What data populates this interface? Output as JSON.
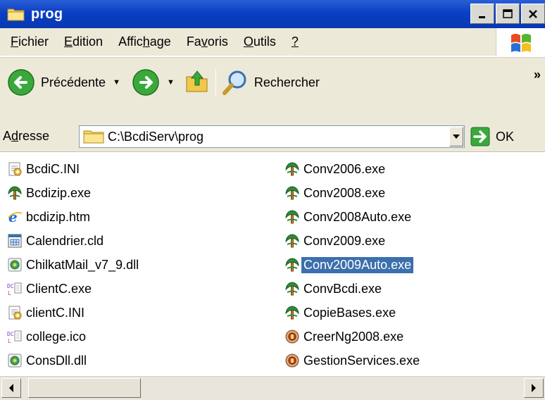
{
  "window": {
    "title": "prog"
  },
  "menu": [
    {
      "pre": "",
      "u": "F",
      "post": "ichier"
    },
    {
      "pre": "",
      "u": "E",
      "post": "dition"
    },
    {
      "pre": "Affic",
      "u": "h",
      "post": "age"
    },
    {
      "pre": "Fa",
      "u": "v",
      "post": "oris"
    },
    {
      "pre": "",
      "u": "O",
      "post": "utils"
    },
    {
      "pre": "",
      "u": "?",
      "post": ""
    }
  ],
  "toolbar": {
    "back_label": "Précédente",
    "search_label": "Rechercher",
    "more": "»"
  },
  "address": {
    "label_pre": "A",
    "label_u": "d",
    "label_post": "resse",
    "value": "C:\\BcdiServ\\prog",
    "go_label": "OK"
  },
  "files": {
    "left": [
      {
        "name": "BcdiC.INI",
        "icon": "ini-icon"
      },
      {
        "name": "Bcdizip.exe",
        "icon": "bcdi-exe-icon"
      },
      {
        "name": "bcdizip.htm",
        "icon": "ie-html-icon"
      },
      {
        "name": "Calendrier.cld",
        "icon": "calendar-file-icon"
      },
      {
        "name": "ChilkatMail_v7_9.dll",
        "icon": "dll-icon"
      },
      {
        "name": "ClientC.exe",
        "icon": "exe-generic-icon"
      },
      {
        "name": "clientC.INI",
        "icon": "ini-icon"
      },
      {
        "name": "college.ico",
        "icon": "exe-generic-icon"
      },
      {
        "name": "ConsDll.dll",
        "icon": "dll-icon"
      }
    ],
    "right": [
      {
        "name": "Conv2006.exe",
        "icon": "bcdi-exe-icon"
      },
      {
        "name": "Conv2008.exe",
        "icon": "bcdi-exe-icon"
      },
      {
        "name": "Conv2008Auto.exe",
        "icon": "bcdi-exe-icon"
      },
      {
        "name": "Conv2009.exe",
        "icon": "bcdi-exe-icon"
      },
      {
        "name": "Conv2009Auto.exe",
        "icon": "bcdi-exe-icon",
        "selected": true
      },
      {
        "name": "ConvBcdi.exe",
        "icon": "bcdi-exe-icon"
      },
      {
        "name": "CopieBases.exe",
        "icon": "bcdi-exe-icon"
      },
      {
        "name": "CreerNg2008.exe",
        "icon": "setup-exe-icon"
      },
      {
        "name": "GestionServices.exe",
        "icon": "setup-exe-icon"
      }
    ]
  },
  "colors": {
    "titlebar": "#0a3fc4",
    "selection": "#3b6fad",
    "chrome": "#ece9d8"
  }
}
